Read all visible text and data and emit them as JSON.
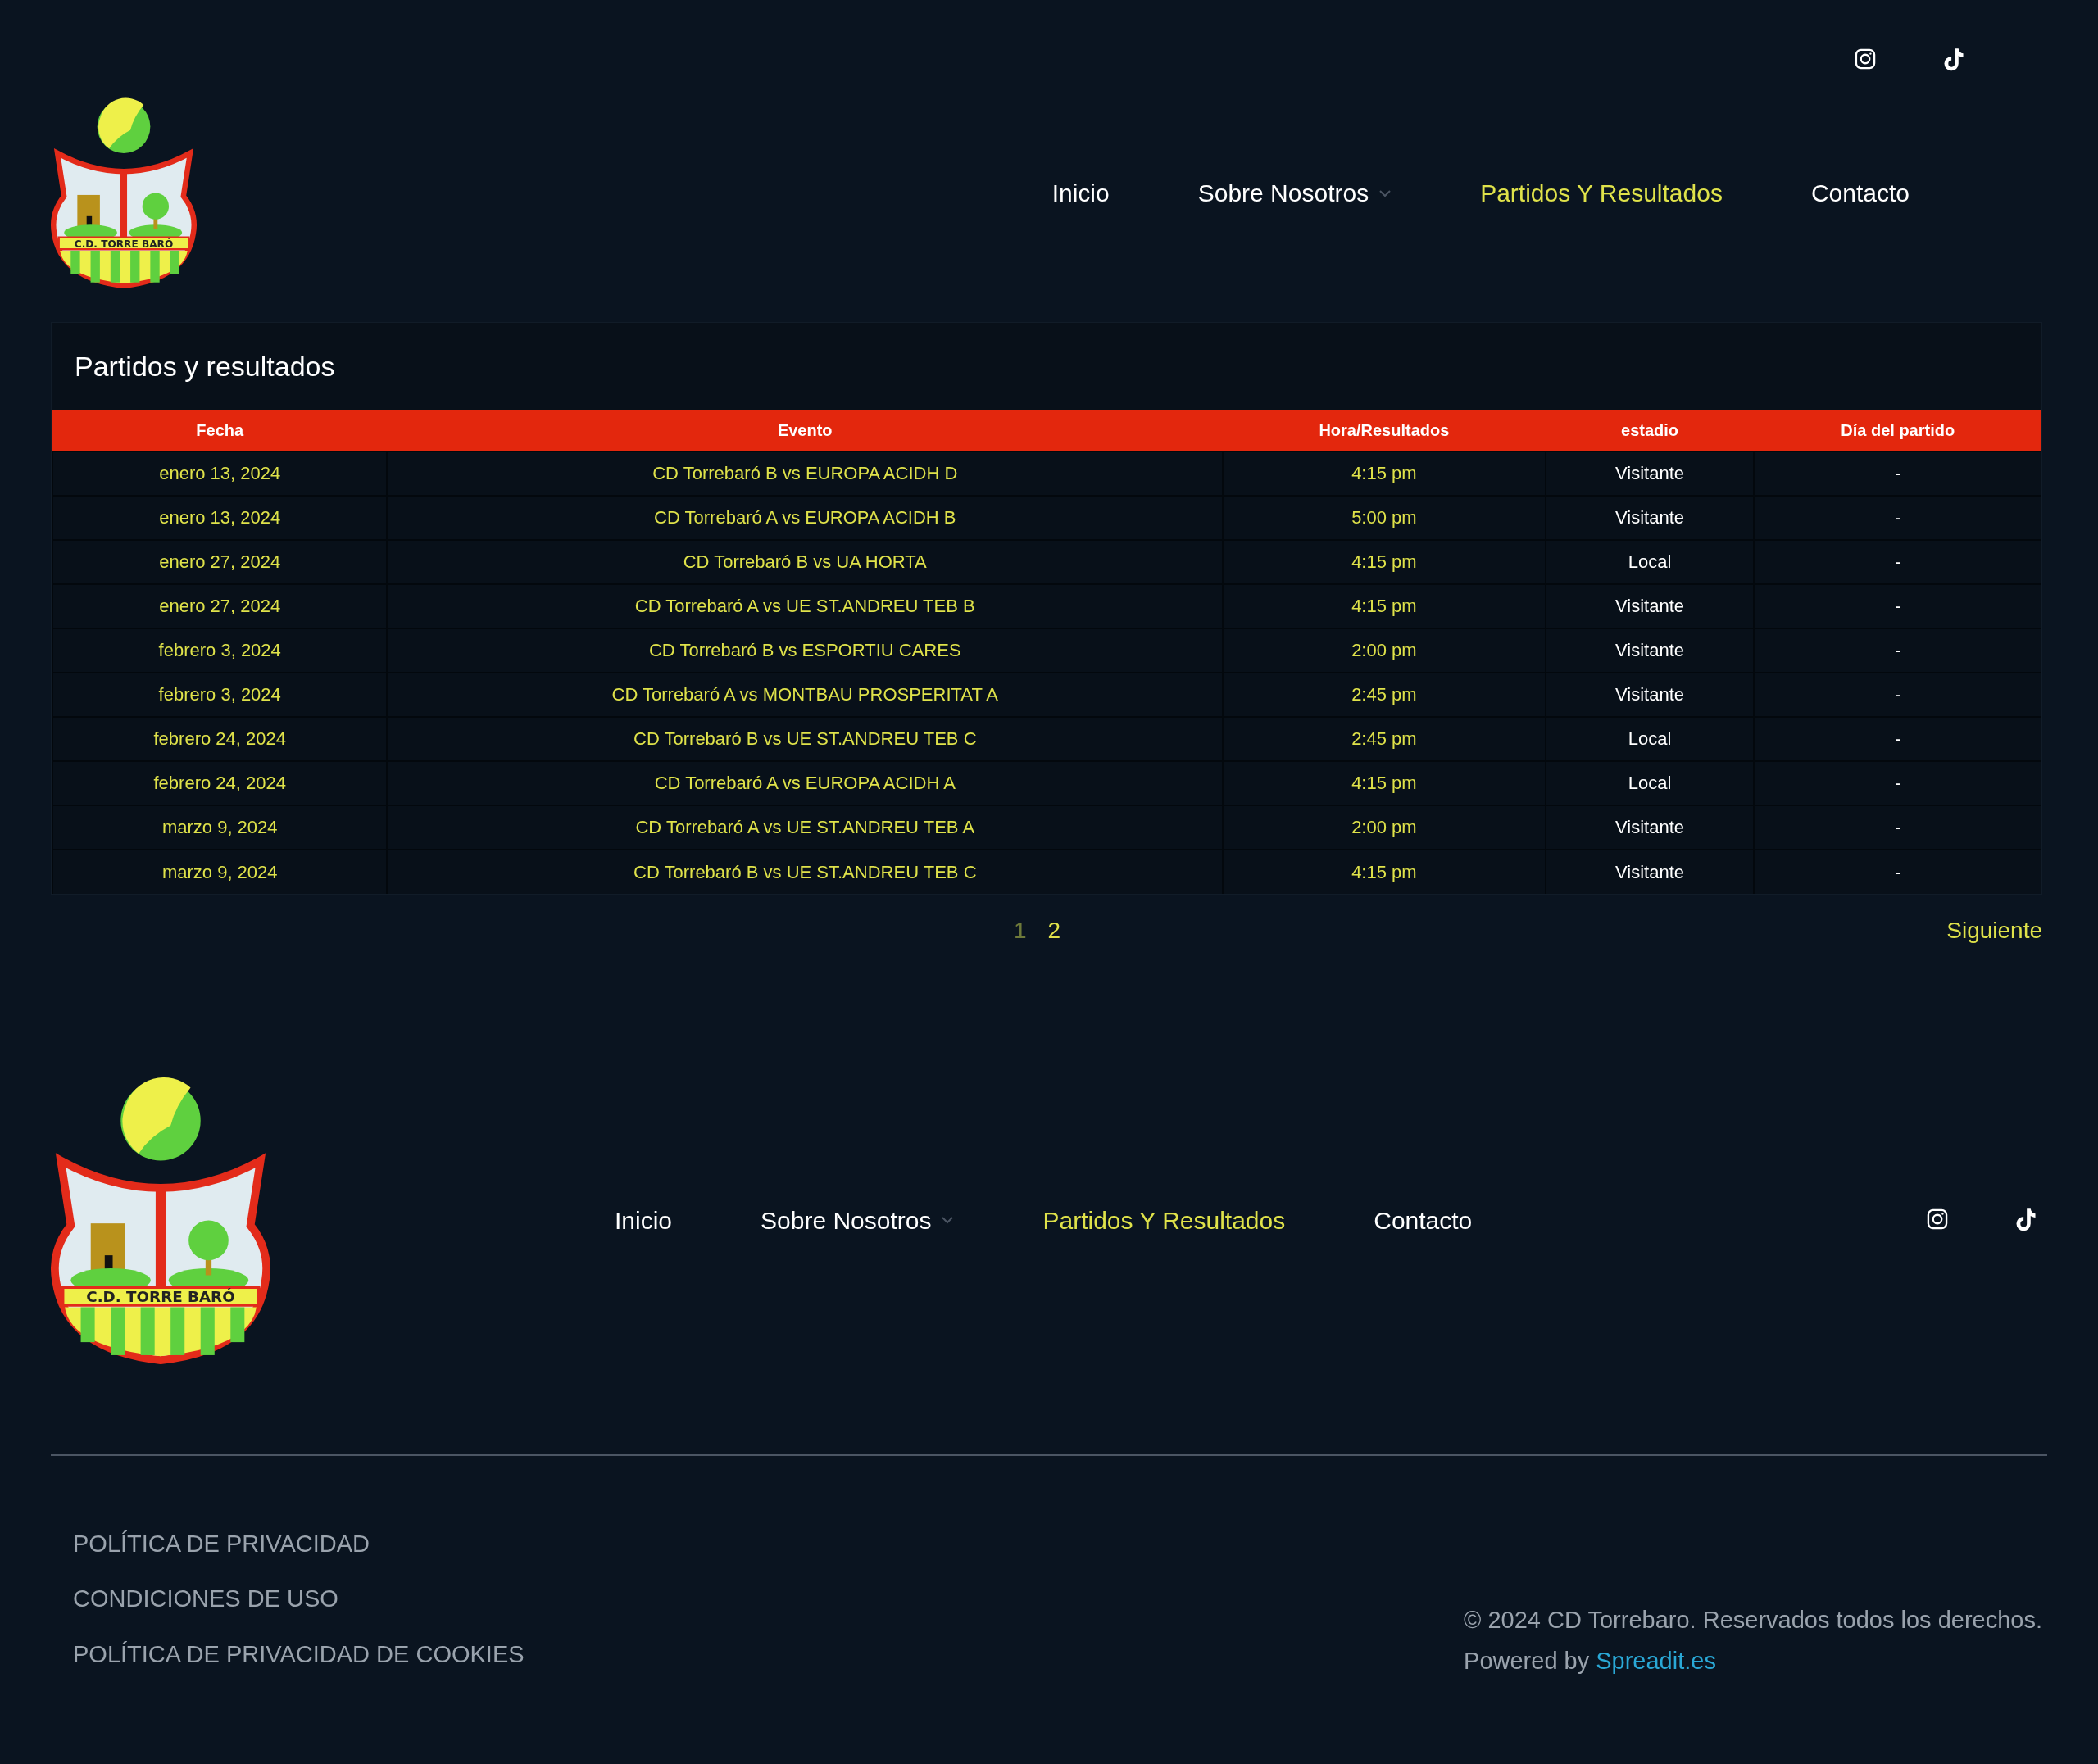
{
  "header": {
    "logo_text": "C.D. TORRE BARÓ",
    "nav": [
      {
        "label": "Inicio",
        "selected": false,
        "has_dropdown": false
      },
      {
        "label": "Sobre Nosotros",
        "selected": false,
        "has_dropdown": true
      },
      {
        "label": "Partidos Y Resultados",
        "selected": true,
        "has_dropdown": false
      },
      {
        "label": "Contacto",
        "selected": false,
        "has_dropdown": false
      }
    ]
  },
  "matches": {
    "title": "Partidos y resultados",
    "columns": [
      "Fecha",
      "Evento",
      "Hora/Resultados",
      "estadio",
      "Día del partido"
    ],
    "rows": [
      [
        "enero 13, 2024",
        "CD Torrebaró B vs EUROPA ACIDH D",
        "4:15 pm",
        "Visitante",
        "-"
      ],
      [
        "enero 13, 2024",
        "CD Torrebaró A vs EUROPA ACIDH B",
        "5:00 pm",
        "Visitante",
        "-"
      ],
      [
        "enero 27, 2024",
        "CD Torrebaró B vs UA HORTA",
        "4:15 pm",
        "Local",
        "-"
      ],
      [
        "enero 27, 2024",
        "CD Torrebaró A vs UE ST.ANDREU TEB B",
        "4:15 pm",
        "Visitante",
        "-"
      ],
      [
        "febrero 3, 2024",
        "CD Torrebaró B vs ESPORTIU CARES",
        "2:00 pm",
        "Visitante",
        "-"
      ],
      [
        "febrero 3, 2024",
        "CD Torrebaró A vs MONTBAU PROSPERITAT A",
        "2:45 pm",
        "Visitante",
        "-"
      ],
      [
        "febrero 24, 2024",
        "CD Torrebaró B vs UE ST.ANDREU TEB C",
        "2:45 pm",
        "Local",
        "-"
      ],
      [
        "febrero 24, 2024",
        "CD Torrebaró A vs EUROPA ACIDH A",
        "4:15 pm",
        "Local",
        "-"
      ],
      [
        "marzo 9, 2024",
        "CD Torrebaró A vs UE ST.ANDREU TEB A",
        "2:00 pm",
        "Visitante",
        "-"
      ],
      [
        "marzo 9, 2024",
        "CD Torrebaró B vs UE ST.ANDREU TEB C",
        "4:15 pm",
        "Visitante",
        "-"
      ]
    ],
    "pages": [
      {
        "label": "1",
        "selected": true
      },
      {
        "label": "2",
        "selected": false
      }
    ],
    "next": "Siguiente"
  },
  "footer": {
    "logo_text": "C.D. TORRE BARÓ",
    "nav": [
      {
        "label": "Inicio",
        "selected": false,
        "has_dropdown": false
      },
      {
        "label": "Sobre Nosotros",
        "selected": false,
        "has_dropdown": true
      },
      {
        "label": "Partidos Y Resultados",
        "selected": true,
        "has_dropdown": false
      },
      {
        "label": "Contacto",
        "selected": false,
        "has_dropdown": false
      }
    ],
    "legal_links": [
      "POLÍTICA DE PRIVACIDAD",
      "CONDICIONES DE USO",
      "POLÍTICA DE PRIVACIDAD DE COOKIES"
    ],
    "copyright": "© 2024 CD Torrebaro. Reservados todos los derechos.",
    "powered_by": "Powered by",
    "powered_link": "Spreadit.es"
  }
}
